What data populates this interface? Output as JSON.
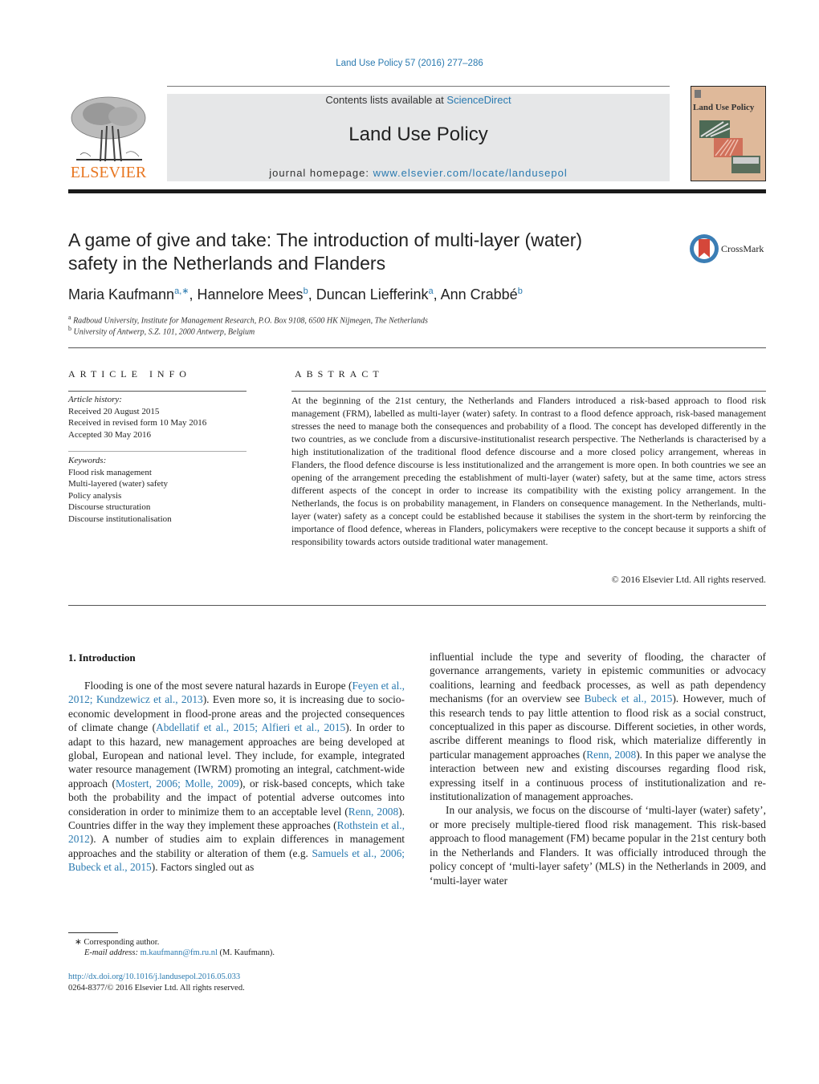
{
  "header": {
    "citation": "Land Use Policy 57 (2016) 277–286",
    "contents_prefix": "Contents lists available at ",
    "contents_link": "ScienceDirect",
    "journal_title": "Land Use Policy",
    "homepage_prefix": "journal homepage: ",
    "homepage_link": "www.elsevier.com/locate/landusepol",
    "publisher_logo_text": "ELSEVIER",
    "cover_title": "Land Use Policy",
    "brand_color": "#e87722",
    "link_color": "#2a7ab0"
  },
  "article": {
    "title_line1": "A game of give and take: The introduction of multi-layer (water)",
    "title_line2": "safety in the Netherlands and Flanders",
    "crossmark_label": "CrossMark",
    "authors": [
      {
        "name": "Maria Kaufmann",
        "sup": "a,∗"
      },
      {
        "name": "Hannelore Mees",
        "sup": "b"
      },
      {
        "name": "Duncan Liefferink",
        "sup": "a"
      },
      {
        "name": "Ann Crabbé",
        "sup": "b"
      }
    ],
    "affiliations": [
      {
        "sup": "a",
        "text": "Radboud University, Institute for Management Research, P.O. Box 9108, 6500 HK Nijmegen, The Netherlands"
      },
      {
        "sup": "b",
        "text": "University of Antwerp, S.Z. 101, 2000 Antwerp, Belgium"
      }
    ]
  },
  "article_info": {
    "heading": "ARTICLE INFO",
    "history_label": "Article history:",
    "history": [
      "Received 20 August 2015",
      "Received in revised form 10 May 2016",
      "Accepted 30 May 2016"
    ],
    "keywords_label": "Keywords:",
    "keywords": [
      "Flood risk management",
      "Multi-layered (water) safety",
      "Policy analysis",
      "Discourse structuration",
      "Discourse institutionalisation"
    ]
  },
  "abstract": {
    "heading": "ABSTRACT",
    "text": "At the beginning of the 21st century, the Netherlands and Flanders introduced a risk-based approach to flood risk management (FRM), labelled as multi-layer (water) safety. In contrast to a flood defence approach, risk-based management stresses the need to manage both the consequences and probability of a flood. The concept has developed differently in the two countries, as we conclude from a discursive-institutionalist research perspective. The Netherlands is characterised by a high institutionalization of the traditional flood defence discourse and a more closed policy arrangement, whereas in Flanders, the flood defence discourse is less institutionalized and the arrangement is more open. In both countries we see an opening of the arrangement preceding the establishment of multi-layer (water) safety, but at the same time, actors stress different aspects of the concept in order to increase its compatibility with the existing policy arrangement. In the Netherlands, the focus is on probability management, in Flanders on consequence management. In the Netherlands, multi-layer (water) safety as a concept could be established because it stabilises the system in the short-term by reinforcing the importance of flood defence, whereas in Flanders, policymakers were receptive to the concept because it supports a shift of responsibility towards actors outside traditional water management.",
    "copyright": "© 2016 Elsevier Ltd. All rights reserved."
  },
  "introduction": {
    "heading": "1.  Introduction",
    "left_col": [
      {
        "t": "Flooding is one of the most severe natural hazards in Europe ("
      },
      {
        "l": "Feyen et al., 2012; Kundzewicz et al., 2013"
      },
      {
        "t": "). Even more so, it is increasing due to socio-economic development in flood-prone areas and the projected consequences of climate change ("
      },
      {
        "l": "Abdellatif et al., 2015; Alfieri et al., 2015"
      },
      {
        "t": "). In order to adapt to this hazard, new management approaches are being developed at global, European and national level. They include, for example, integrated water resource management (IWRM) promoting an integral, catchment-wide approach ("
      },
      {
        "l": "Mostert, 2006; Molle, 2009"
      },
      {
        "t": "), or risk-based concepts, which take both the probability and the impact of potential adverse outcomes into consideration in order to minimize them to an acceptable level ("
      },
      {
        "l": "Renn, 2008"
      },
      {
        "t": "). Countries differ in the way they implement these approaches ("
      },
      {
        "l": "Rothstein et al., 2012"
      },
      {
        "t": "). A number of studies aim to explain differences in management approaches and the stability or alteration of them (e.g. "
      },
      {
        "l": "Samuels et al., 2006; Bubeck et al., 2015"
      },
      {
        "t": "). Factors singled out as"
      }
    ],
    "right_col_p1": [
      {
        "t": "influential include the type and severity of flooding, the character of governance arrangements, variety in epistemic communities or advocacy coalitions, learning and feedback processes, as well as path dependency mechanisms (for an overview see "
      },
      {
        "l": "Bubeck et al., 2015"
      },
      {
        "t": "). However, much of this research tends to pay little attention to flood risk as a social construct, conceptualized in this paper as discourse. Different societies, in other words, ascribe different meanings to flood risk, which materialize differently in particular management approaches ("
      },
      {
        "l": "Renn, 2008"
      },
      {
        "t": "). In this paper we analyse the interaction between new and existing discourses regarding flood risk, expressing itself in a continuous process of institutionalization and re-institutionalization of management approaches."
      }
    ],
    "right_col_p2": "In our analysis, we focus on the discourse of ‘multi-layer (water) safety’, or more precisely multiple-tiered flood risk management. This risk-based approach to flood management (FM) became popular in the 21st century both in the Netherlands and Flanders. It was officially introduced through the policy concept of ‘multi-layer safety’ (MLS) in the Netherlands in 2009, and ‘multi-layer water"
  },
  "footer": {
    "corresponding": "∗  Corresponding author.",
    "email_label": "E-mail address: ",
    "email": "m.kaufmann@fm.ru.nl",
    "email_suffix": " (M. Kaufmann).",
    "doi": "http://dx.doi.org/10.1016/j.landusepol.2016.05.033",
    "issn": "0264-8377/© 2016 Elsevier Ltd. All rights reserved."
  }
}
